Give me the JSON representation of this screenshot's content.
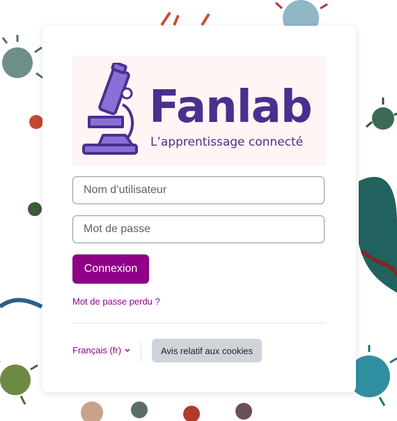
{
  "logo": {
    "name": "Fanlab",
    "tagline": "L’apprentissage connecté",
    "brand_color": "#4b2f8e",
    "icon": "microscope-icon"
  },
  "login": {
    "username_placeholder": "Nom d’utilisateur",
    "password_placeholder": "Mot de passe",
    "submit_label": "Connexion",
    "forgot_label": "Mot de passe perdu ?"
  },
  "footer": {
    "language_label": "Français (fr)",
    "cookies_label": "Avis relatif aux cookies"
  },
  "colors": {
    "accent": "#8f0087",
    "secondary_button": "#ced4da"
  }
}
